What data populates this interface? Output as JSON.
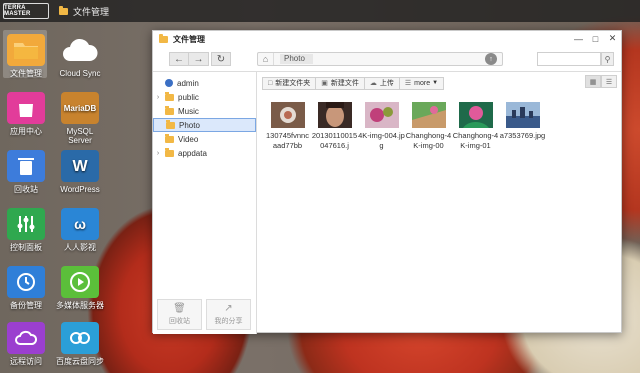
{
  "topbar": {
    "brand": "TERRA MASTER",
    "app_title": "文件管理"
  },
  "desktop": [
    {
      "label": "文件管理",
      "icon": "folder-icon",
      "color": "#f2a93b"
    },
    {
      "label": "Cloud Sync",
      "icon": "cloud-sync-icon",
      "color": "#ffffff"
    },
    {
      "label": "应用中心",
      "icon": "shopping-bag-icon",
      "color": "#e23c9a"
    },
    {
      "label": "MySQL Server",
      "icon": "mariadb-icon",
      "color": "#f0a64a"
    },
    {
      "label": "回收站",
      "icon": "trash-icon",
      "color": "#3d7cdb"
    },
    {
      "label": "WordPress",
      "icon": "wordpress-icon",
      "color": "#2a6aa8"
    },
    {
      "label": "控制面板",
      "icon": "sliders-icon",
      "color": "#2fa84f"
    },
    {
      "label": "人人影视",
      "icon": "rrys-icon",
      "color": "#2a86d6"
    },
    {
      "label": "备份管理",
      "icon": "clock-icon",
      "color": "#2f7fd8"
    },
    {
      "label": "多媒体服务器",
      "icon": "play-icon",
      "color": "#5bbf3a"
    },
    {
      "label": "远程访问",
      "icon": "cloud-icon",
      "color": "#9b3fcf"
    },
    {
      "label": "百度云盘同步",
      "icon": "baidu-icon",
      "color": "#2b9fd8"
    }
  ],
  "window": {
    "title": "文件管理",
    "controls": {
      "minimize": "—",
      "maximize": "□",
      "close": "✕"
    },
    "address": {
      "crumb": "Photo"
    },
    "sidebar": {
      "items": [
        {
          "label": "admin",
          "expandable": false
        },
        {
          "label": "public",
          "expandable": true
        },
        {
          "label": "Music",
          "expandable": false
        },
        {
          "label": "Photo",
          "expandable": false,
          "selected": true
        },
        {
          "label": "Video",
          "expandable": false
        },
        {
          "label": "appdata",
          "expandable": true
        }
      ],
      "recycle_label": "回收站",
      "share_label": "我的分享"
    },
    "toolbar": {
      "new_folder": "新建文件夹",
      "new_file": "新建文件",
      "upload": "上传",
      "more": "more"
    },
    "files": [
      {
        "name": "130745fvnncaad77bb",
        "thumb_color": "#6b4a3a"
      },
      {
        "name": "20130110015047616.j",
        "thumb_color": "#8a6a55"
      },
      {
        "name": "4K-img-004.jpg",
        "thumb_color": "#c04a7a"
      },
      {
        "name": "Changhong-4K-img-00",
        "thumb_color": "#5a9a4a"
      },
      {
        "name": "Changhong-4K-img-01",
        "thumb_color": "#2a8a6a"
      },
      {
        "name": "a7353769.jpg",
        "thumb_color": "#6a8ab0"
      }
    ]
  }
}
